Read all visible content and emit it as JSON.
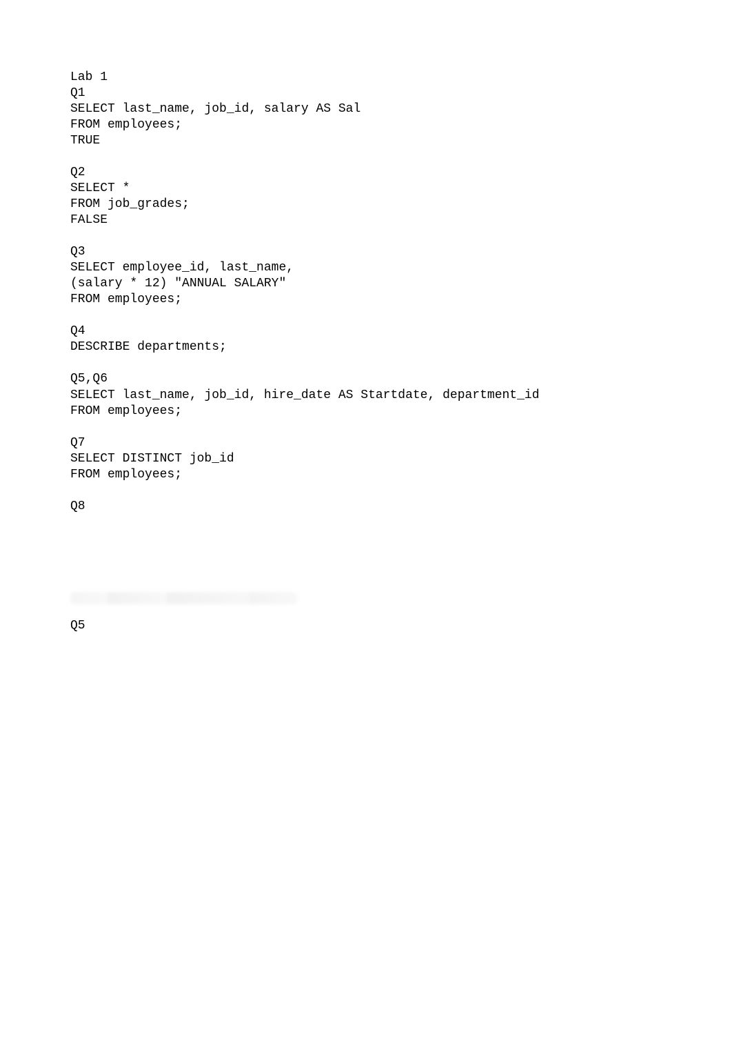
{
  "doc": {
    "title": "Lab 1",
    "sections": [
      {
        "heading": "Q1",
        "lines": [
          "SELECT last_name, job_id, salary AS Sal",
          "FROM employees;",
          "TRUE"
        ]
      },
      {
        "heading": "Q2",
        "lines": [
          "SELECT *",
          "FROM job_grades;",
          "FALSE"
        ]
      },
      {
        "heading": "Q3",
        "lines": [
          "SELECT employee_id, last_name,",
          "(salary * 12) \"ANNUAL SALARY\"",
          "FROM employees;"
        ]
      },
      {
        "heading": "Q4",
        "lines": [
          "DESCRIBE departments;"
        ]
      },
      {
        "heading": "Q5,Q6",
        "lines": [
          "SELECT last_name, job_id, hire_date AS Startdate, department_id",
          "FROM employees;"
        ]
      },
      {
        "heading": "Q7",
        "lines": [
          "SELECT DISTINCT job_id",
          "FROM employees;"
        ]
      },
      {
        "heading": "Q8",
        "lines": []
      }
    ],
    "trailing_label": "Q5"
  }
}
